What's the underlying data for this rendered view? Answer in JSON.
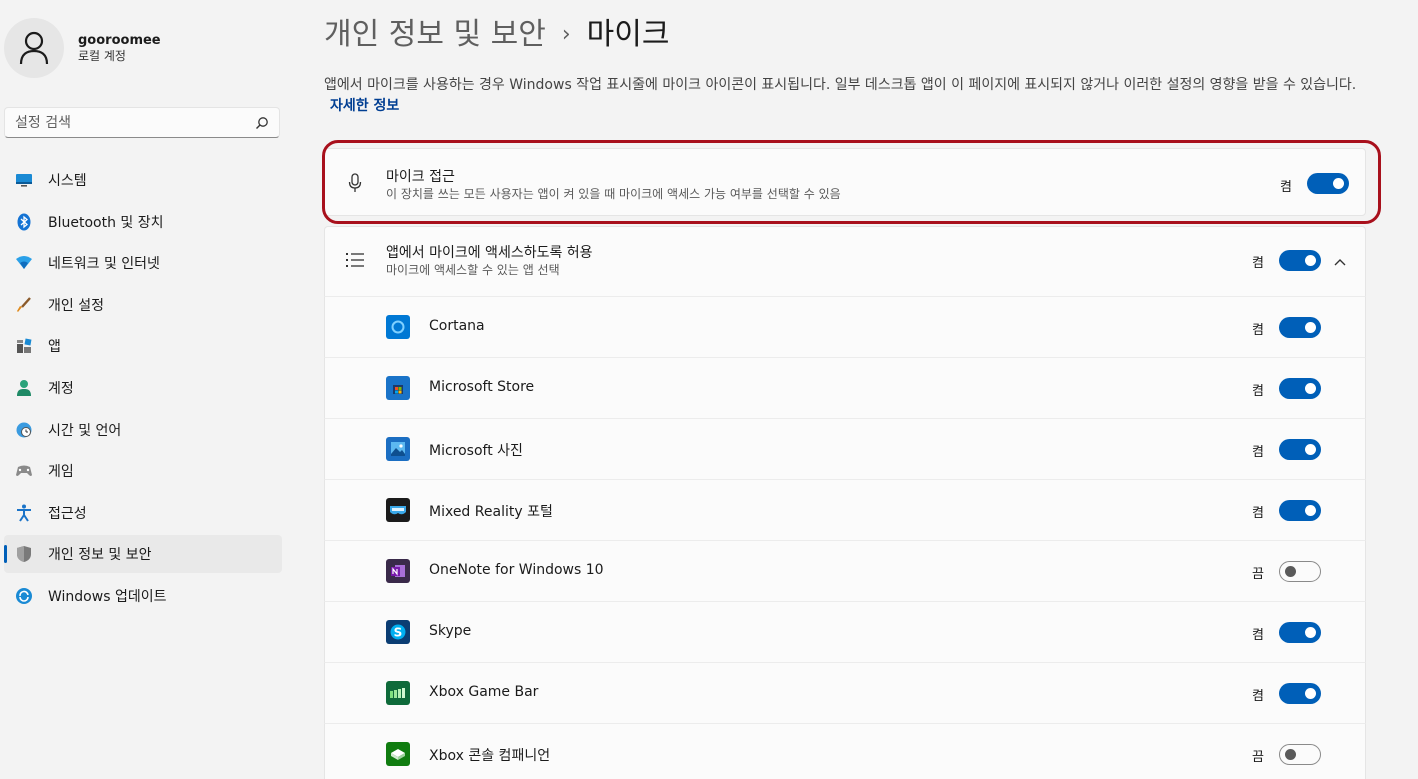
{
  "user": {
    "name": "gooroomee",
    "account_type": "로컬 계정"
  },
  "search": {
    "placeholder": "설정 검색"
  },
  "nav": [
    {
      "label": "시스템",
      "icon": "monitor-icon"
    },
    {
      "label": "Bluetooth 및 장치",
      "icon": "bluetooth-icon"
    },
    {
      "label": "네트워크 및 인터넷",
      "icon": "wifi-icon"
    },
    {
      "label": "개인 설정",
      "icon": "brush-icon"
    },
    {
      "label": "앱",
      "icon": "apps-icon"
    },
    {
      "label": "계정",
      "icon": "person-icon"
    },
    {
      "label": "시간 및 언어",
      "icon": "globe-clock-icon"
    },
    {
      "label": "게임",
      "icon": "gamepad-icon"
    },
    {
      "label": "접근성",
      "icon": "accessibility-icon"
    },
    {
      "label": "개인 정보 및 보안",
      "icon": "shield-icon",
      "active": true
    },
    {
      "label": "Windows 업데이트",
      "icon": "update-icon"
    }
  ],
  "breadcrumb": {
    "parent": "개인 정보 및 보안",
    "separator": "›",
    "current": "마이크"
  },
  "description": {
    "text": "앱에서 마이크를 사용하는 경우 Windows 작업 표시줄에 마이크 아이콘이 표시됩니다. 일부 데스크톱 앱이 이 페이지에 표시되지 않거나 이러한 설정의 영향을 받을 수 있습니다.",
    "link": "자세한 정보"
  },
  "mic_access": {
    "title": "마이크 접근",
    "subtitle": "이 장치를 쓰는 모든 사용자는 앱이 켜 있을 때 마이크에 액세스 가능 여부를 선택할 수 있음",
    "state": "켬",
    "on": true
  },
  "app_access": {
    "title": "앱에서 마이크에 액세스하도록 허용",
    "subtitle": "마이크에 액세스할 수 있는 앱 선택",
    "state": "켬",
    "on": true
  },
  "apps": [
    {
      "name": "Cortana",
      "state": "켬",
      "on": true,
      "icon": "cortana-icon",
      "color": "#0078d4"
    },
    {
      "name": "Microsoft Store",
      "state": "켬",
      "on": true,
      "icon": "store-icon",
      "color": "#1a73c8"
    },
    {
      "name": "Microsoft 사진",
      "state": "켬",
      "on": true,
      "icon": "photos-icon",
      "color": "#1b6ec2"
    },
    {
      "name": "Mixed Reality 포털",
      "state": "켬",
      "on": true,
      "icon": "mixed-reality-icon",
      "color": "#1b1b1b"
    },
    {
      "name": "OneNote for Windows 10",
      "state": "끔",
      "on": false,
      "icon": "onenote-icon",
      "color": "#7719aa"
    },
    {
      "name": "Skype",
      "state": "켬",
      "on": true,
      "icon": "skype-icon",
      "color": "#0078d4"
    },
    {
      "name": "Xbox Game Bar",
      "state": "켬",
      "on": true,
      "icon": "xbox-game-bar-icon",
      "color": "#2b8a3e"
    },
    {
      "name": "Xbox 콘솔 컴패니언",
      "state": "끔",
      "on": false,
      "icon": "xbox-companion-icon",
      "color": "#107c10"
    }
  ]
}
